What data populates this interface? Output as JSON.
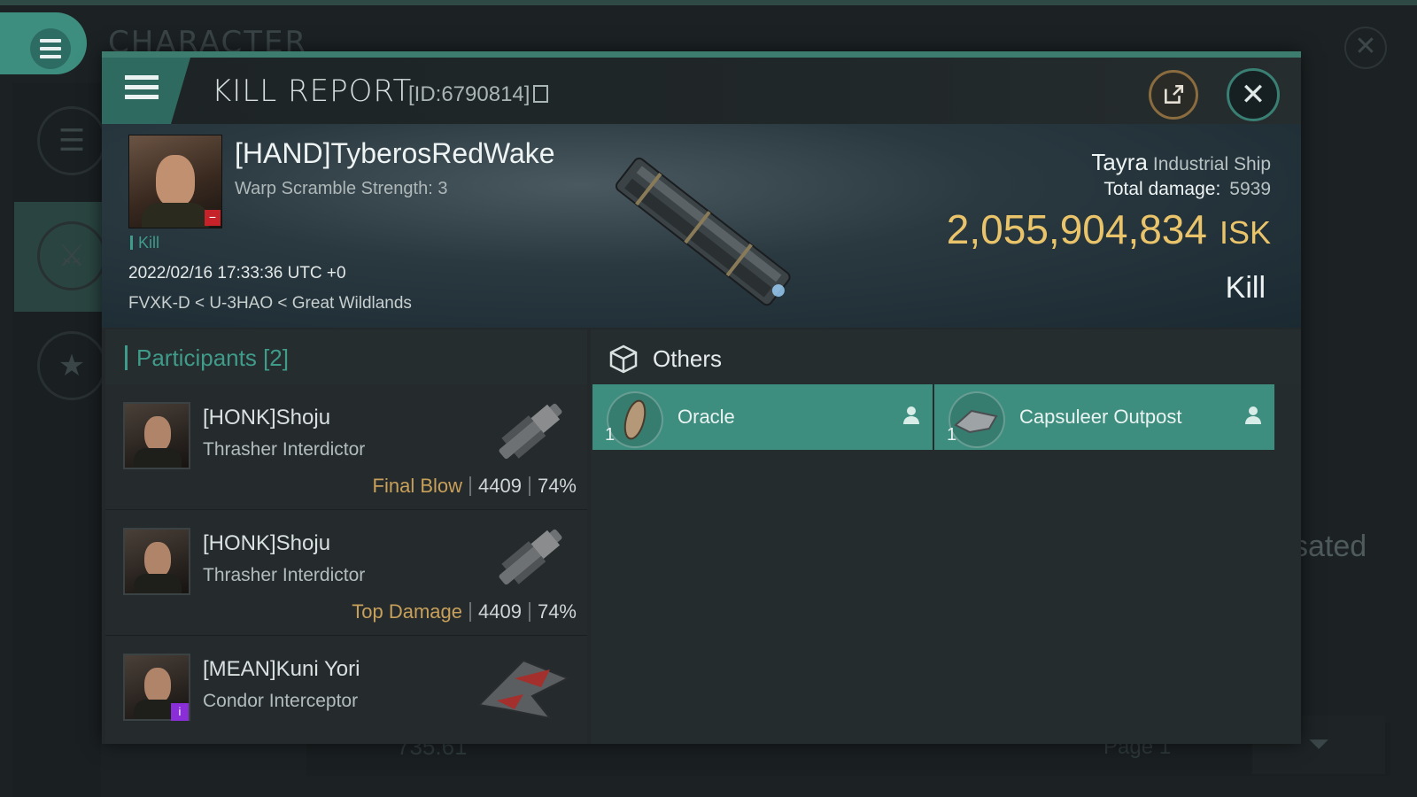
{
  "background": {
    "title": "CHARACTER",
    "partial_text": "sated",
    "bottom_value": "735.61",
    "page_label": "Page 1"
  },
  "modal": {
    "title": "KILL REPORT",
    "id_label": "[ID:6790814]",
    "victim": {
      "name": "[HAND]TyberosRedWake",
      "warp_scramble": "Warp Scramble Strength: 3",
      "kill_tag": "Kill",
      "datetime": "2022/02/16 17:33:36 UTC +0",
      "location": "FVXK-D < U-3HAO < Great Wildlands",
      "standing_badge": "−"
    },
    "ship": {
      "name": "Tayra",
      "class": "Industrial Ship",
      "damage_label": "Total damage:",
      "damage_value": "5939",
      "isk_value": "2,055,904,834",
      "isk_unit": "ISK",
      "result": "Kill"
    },
    "participants": {
      "header": "Participants",
      "count": "[2]",
      "rows": [
        {
          "name": "[HONK]Shoju",
          "ship": "Thrasher Interdictor",
          "tag": "Final Blow",
          "damage": "4409",
          "percent": "74%"
        },
        {
          "name": "[HONK]Shoju",
          "ship": "Thrasher Interdictor",
          "tag": "Top Damage",
          "damage": "4409",
          "percent": "74%"
        },
        {
          "name": "[MEAN]Kuni Yori",
          "ship": "Condor Interceptor",
          "badge": "i"
        }
      ]
    },
    "others": {
      "title": "Others",
      "items": [
        {
          "name": "Oracle",
          "qty": "1"
        },
        {
          "name": "Capsuleer Outpost",
          "qty": "1"
        }
      ]
    }
  },
  "colors": {
    "accent_teal": "#3e8e7f",
    "isk_gold": "#e9c46a",
    "tag_gold": "#c8a05a",
    "standing_red": "#c5222a"
  },
  "icons": [
    "menu-icon",
    "copy-icon",
    "share-icon",
    "close-icon",
    "cube-icon",
    "person-icon",
    "crossed-swords-icon",
    "star-icon"
  ]
}
